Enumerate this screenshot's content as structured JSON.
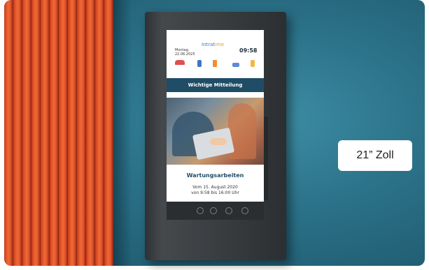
{
  "display": {
    "date_weekday": "Montag,",
    "date_value": "22.06.2025",
    "brand_main": "Intrat",
    "brand_accent": "ime",
    "time": "09:58",
    "banner": "Wichtige Mitteilung",
    "notice_title": "Wartungsarbeiten",
    "notice_line_1": "Vom 15. August 2020",
    "notice_line_2": "von 9:58 bis 16:00 Uhr"
  },
  "header_icons": [
    "bus-icon",
    "building-icon",
    "cup-icon",
    "ship-icon",
    "bell-icon"
  ],
  "hardware_buttons": [
    "info-icon",
    "menu-icon",
    "settings-icon",
    "wifi-icon"
  ],
  "badge": {
    "label": "21” Zoll"
  },
  "colors": {
    "banner": "#1f4d66",
    "brand": "#2f7fc0",
    "brand_accent": "#f09a3a",
    "wall": "#2b7188",
    "slats": "#e0562a"
  }
}
